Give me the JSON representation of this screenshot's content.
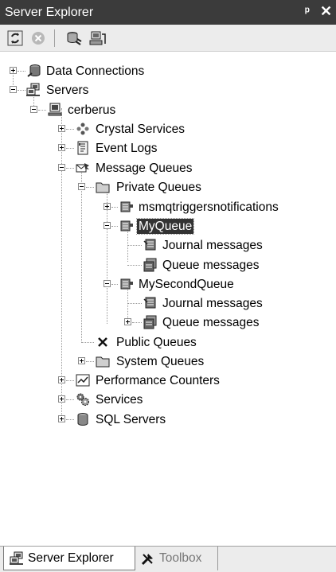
{
  "window": {
    "title": "Server Explorer",
    "pin_glyph": "ᵖ",
    "close_glyph": "✕"
  },
  "toolbar": {
    "buttons": [
      {
        "name": "refresh-icon"
      },
      {
        "name": "stop-icon"
      },
      {
        "name": "connect-to-database-icon"
      },
      {
        "name": "connect-to-server-icon"
      }
    ]
  },
  "tree": {
    "data_connections": "Data Connections",
    "servers": "Servers",
    "cerberus": "cerberus",
    "crystal_services": "Crystal Services",
    "event_logs": "Event Logs",
    "message_queues": "Message Queues",
    "private_queues": "Private Queues",
    "msmqtriggers": "msmqtriggersnotifications",
    "myqueue": "MyQueue",
    "myqueue_journal": "Journal messages",
    "myqueue_queue": "Queue messages",
    "mysecondqueue": "MySecondQueue",
    "mysecond_journal": "Journal messages",
    "mysecond_queue": "Queue messages",
    "public_queues": "Public Queues",
    "system_queues": "System Queues",
    "performance_counters": "Performance Counters",
    "services": "Services",
    "sql_servers": "SQL Servers",
    "selected": "MyQueue"
  },
  "tabs": {
    "server_explorer": "Server Explorer",
    "toolbox": "Toolbox",
    "active": "Server Explorer"
  },
  "colors": {
    "titlebar": "#3b3b3b",
    "selection": "#333333",
    "toolbar": "#ececec"
  }
}
